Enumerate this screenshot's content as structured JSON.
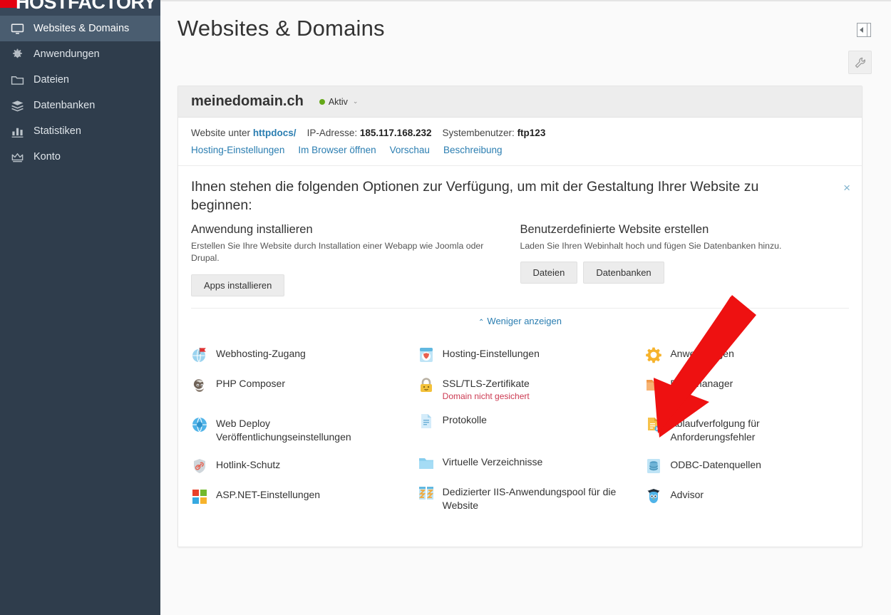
{
  "brand": {
    "name": "HOSTFACTORY",
    "mark_color": "#e3000f"
  },
  "sidebar": {
    "items": [
      {
        "label": "Websites & Domains",
        "icon": "monitor-icon",
        "active": true
      },
      {
        "label": "Anwendungen",
        "icon": "gear-icon",
        "active": false
      },
      {
        "label": "Dateien",
        "icon": "folder-icon",
        "active": false
      },
      {
        "label": "Datenbanken",
        "icon": "database-stack-icon",
        "active": false
      },
      {
        "label": "Statistiken",
        "icon": "bar-chart-icon",
        "active": false
      },
      {
        "label": "Konto",
        "icon": "crown-icon",
        "active": false
      }
    ],
    "collapse_handle": "‹"
  },
  "header": {
    "title": "Websites & Domains",
    "panel_toggle_icon": "collapse-panel-icon",
    "tools_icon": "wrench-icon"
  },
  "domain_card": {
    "name": "meinedomain.ch",
    "status": {
      "label": "Aktiv",
      "color": "#64a818",
      "caret": "⌄"
    },
    "meta": {
      "site_prefix": "Website unter",
      "site_path": "httpdocs/",
      "ip_label": "IP-Adresse:",
      "ip_value": "185.117.168.232",
      "user_label": "Systembenutzer:",
      "user_value": "ftp123"
    },
    "links": [
      "Hosting-Einstellungen",
      "Im Browser öffnen",
      "Vorschau",
      "Beschreibung"
    ]
  },
  "promo": {
    "title": "Ihnen stehen die folgenden Optionen zur Verfügung, um mit der Gestaltung Ihrer Website zu beginnen:",
    "close_icon": "×",
    "columns": [
      {
        "heading": "Anwendung installieren",
        "text": "Erstellen Sie Ihre Website durch Installation einer Webapp wie Joomla oder Drupal.",
        "buttons": [
          "Apps installieren"
        ]
      },
      {
        "heading": "Benutzerdefinierte Website erstellen",
        "text": "Laden Sie Ihren Webinhalt hoch und fügen Sie Datenbanken hinzu.",
        "buttons": [
          "Dateien",
          "Datenbanken"
        ]
      }
    ],
    "less_label": "Weniger anzeigen",
    "less_chevron": "⌃"
  },
  "tool_grid": {
    "columns": [
      [
        {
          "label": "Webhosting-Zugang",
          "icon": "globe-flag-icon"
        },
        {
          "label": "PHP Composer",
          "icon": "composer-icon"
        },
        {
          "label": "Web Deploy",
          "label2": "Veröffentlichungseinstellungen",
          "icon": "web-deploy-icon"
        },
        {
          "label": "Hotlink-Schutz",
          "icon": "shield-link-icon"
        },
        {
          "label": "ASP.NET-Einstellungen",
          "icon": "aspnet-icon"
        }
      ],
      [
        {
          "label": "Hosting-Einstellungen",
          "icon": "hosting-settings-icon"
        },
        {
          "label": "SSL/TLS-Zertifikate",
          "icon": "lock-icon",
          "sub": "Domain nicht gesichert",
          "sub_color": "#cc3a52"
        },
        {
          "label": "Protokolle",
          "icon": "log-file-icon"
        },
        {
          "label": "Virtuelle Verzeichnisse",
          "icon": "folder-blue-icon"
        },
        {
          "label": "Dedizierter IIS-Anwendungspool für die",
          "label2": "Website",
          "icon": "iis-pool-icon"
        }
      ],
      [
        {
          "label": "Anwendungen",
          "icon": "gear-orange-icon"
        },
        {
          "label": "Dateimanager",
          "icon": "folder-orange-icon"
        },
        {
          "label": "Ablaufverfolgung für",
          "label2": "Anforderungsfehler",
          "icon": "trace-error-icon"
        },
        {
          "label": "ODBC-Datenquellen",
          "icon": "odbc-icon"
        },
        {
          "label": "Advisor",
          "icon": "advisor-owl-icon"
        }
      ]
    ]
  },
  "annotation": {
    "arrow_color": "#ee1111",
    "shape": "down-left-arrow"
  }
}
